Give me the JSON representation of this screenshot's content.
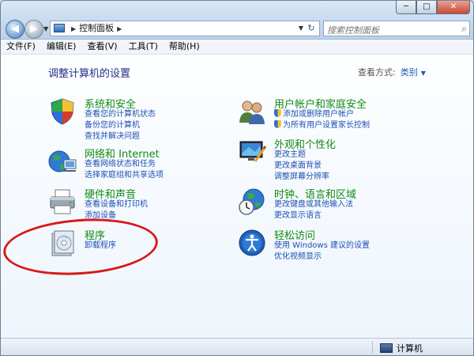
{
  "window": {
    "buttons": {
      "minimize": "─",
      "maximize": "□",
      "close": "✕"
    }
  },
  "nav": {
    "back": "◀",
    "forward": "▶",
    "dropdown": "▼",
    "address_sep_1": "▶",
    "address_path": "控制面板",
    "address_sep_2": "▶",
    "address_dropdown": "▼",
    "refresh": "↻"
  },
  "search": {
    "placeholder": "搜索控制面板",
    "icon": "⌕"
  },
  "menu": {
    "file": "文件(F)",
    "edit": "编辑(E)",
    "view": "查看(V)",
    "tools": "工具(T)",
    "help": "帮助(H)"
  },
  "content": {
    "heading": "调整计算机的设置",
    "view_by_label": "查看方式:",
    "view_by_value": "类别",
    "view_by_arrow": "▼"
  },
  "categories": {
    "system": {
      "title": "系统和安全",
      "links": [
        "查看您的计算机状态",
        "备份您的计算机",
        "查找并解决问题"
      ]
    },
    "network": {
      "title": "网络和 Internet",
      "links": [
        "查看网络状态和任务",
        "选择家庭组和共享选项"
      ]
    },
    "hardware": {
      "title": "硬件和声音",
      "links": [
        "查看设备和打印机",
        "添加设备"
      ]
    },
    "programs": {
      "title": "程序",
      "links": [
        "卸载程序"
      ]
    },
    "users": {
      "title": "用户帐户和家庭安全",
      "links": [
        "添加或删除用户帐户",
        "为所有用户设置家长控制"
      ]
    },
    "appearance": {
      "title": "外观和个性化",
      "links": [
        "更改主题",
        "更改桌面背景",
        "调整屏幕分辨率"
      ]
    },
    "clock": {
      "title": "时钟、语言和区域",
      "links": [
        "更改键盘或其他输入法",
        "更改显示语言"
      ]
    },
    "ease": {
      "title": "轻松访问",
      "links": [
        "使用 Windows 建议的设置",
        "优化视频显示"
      ]
    }
  },
  "statusbar": {
    "computer": "计算机"
  }
}
